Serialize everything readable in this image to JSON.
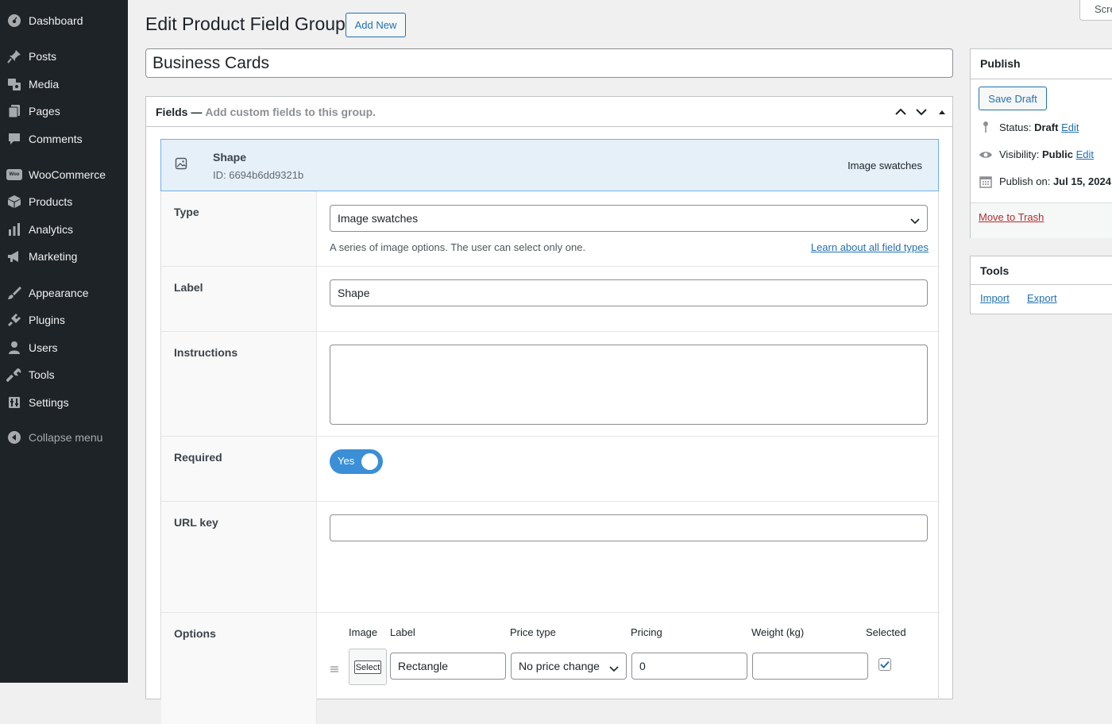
{
  "sidebar": {
    "items": [
      {
        "label": "Dashboard",
        "icon": "dashboard-icon"
      },
      {
        "label": "Posts",
        "icon": "pin-icon"
      },
      {
        "label": "Media",
        "icon": "media-icon"
      },
      {
        "label": "Pages",
        "icon": "pages-icon"
      },
      {
        "label": "Comments",
        "icon": "comments-icon"
      },
      {
        "label": "WooCommerce",
        "icon": "woocommerce-icon",
        "badge": "Woo"
      },
      {
        "label": "Products",
        "icon": "products-icon"
      },
      {
        "label": "Analytics",
        "icon": "analytics-icon"
      },
      {
        "label": "Marketing",
        "icon": "megaphone-icon"
      },
      {
        "label": "Appearance",
        "icon": "paintbrush-icon"
      },
      {
        "label": "Plugins",
        "icon": "plugins-icon"
      },
      {
        "label": "Users",
        "icon": "users-icon"
      },
      {
        "label": "Tools",
        "icon": "wrench-icon"
      },
      {
        "label": "Settings",
        "icon": "settings-icon"
      },
      {
        "label": "Collapse menu",
        "icon": "collapse-icon"
      }
    ]
  },
  "header": {
    "title": "Edit Product Field Group",
    "add_new": "Add New",
    "screen_options": "Screen Options"
  },
  "post_title": "Business Cards",
  "fields_box": {
    "title": "Fields —",
    "subtitle": "Add custom fields to this group.",
    "field": {
      "name": "Shape",
      "id": "ID: 6694b6dd9321b",
      "type": "Image swatches"
    },
    "settings": {
      "type_label": "Type",
      "type_value": "Image swatches",
      "type_help": "A series of image options. The user can select only one.",
      "type_link": "Learn about all field types",
      "label_label": "Label",
      "label_value": "Shape",
      "instructions_label": "Instructions",
      "instructions_value": "",
      "required_label": "Required",
      "required_toggle": "Yes",
      "urlkey_label": "URL key",
      "urlkey_value": "",
      "options_label": "Options",
      "options_columns": [
        "Image",
        "Label",
        "Price type",
        "Pricing",
        "Weight (kg)",
        "Selected"
      ],
      "options_rows": [
        {
          "image_button": "Select",
          "label": "Rectangle",
          "price_type": "No price change",
          "pricing": "0",
          "weight": "",
          "selected": true
        }
      ]
    }
  },
  "publish_box": {
    "title": "Publish",
    "save_draft": "Save Draft",
    "status_label": "Status:",
    "status_value": "Draft",
    "visibility_label": "Visibility:",
    "visibility_value": "Public",
    "publish_label": "Publish on:",
    "publish_value": "Jul 15, 2024",
    "edit": "Edit",
    "trash": "Move to Trash"
  },
  "tools_box": {
    "title": "Tools",
    "import": "Import",
    "export": "Export"
  },
  "colors": {
    "sidebar_bg": "#1d2327",
    "accent": "#2271b1",
    "toggle": "#3a8fd6",
    "selected_row": "#e5f0f9",
    "trash": "#b32d2e"
  }
}
